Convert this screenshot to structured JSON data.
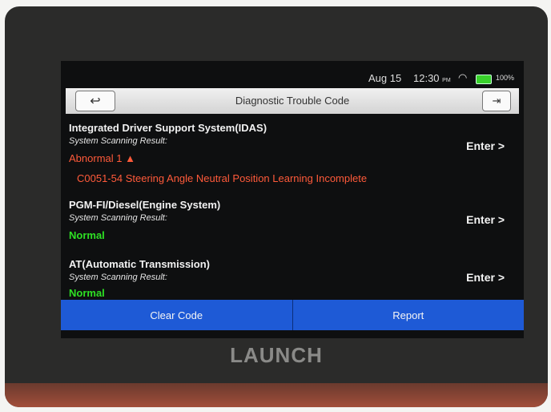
{
  "statusbar": {
    "date": "Aug 15",
    "time": "12:30",
    "ampm": "PM",
    "battery": "100%"
  },
  "header": {
    "title": "Diagnostic Trouble Code",
    "back_icon": "↩",
    "exit_icon": "⇥"
  },
  "systems": [
    {
      "name": "Integrated Driver Support System(IDAS)",
      "scan_label": "System Scanning Result:",
      "status": "Abnormal 1",
      "dtc": "C0051-54 Steering Angle Neutral Position Learning Incomplete",
      "enter": "Enter >"
    },
    {
      "name": "PGM-FI/Diesel(Engine System)",
      "scan_label": "System Scanning Result:",
      "status": "Normal",
      "enter": "Enter >"
    },
    {
      "name": "AT(Automatic Transmission)",
      "scan_label": "System Scanning Result:",
      "status": "Normal",
      "enter": "Enter >"
    }
  ],
  "actions": {
    "clear": "Clear Code",
    "report": "Report"
  },
  "brand": "LAUNCH",
  "colors": {
    "abnormal": "#ff5a3a",
    "normal": "#2ee024",
    "button": "#1e5ad6"
  }
}
